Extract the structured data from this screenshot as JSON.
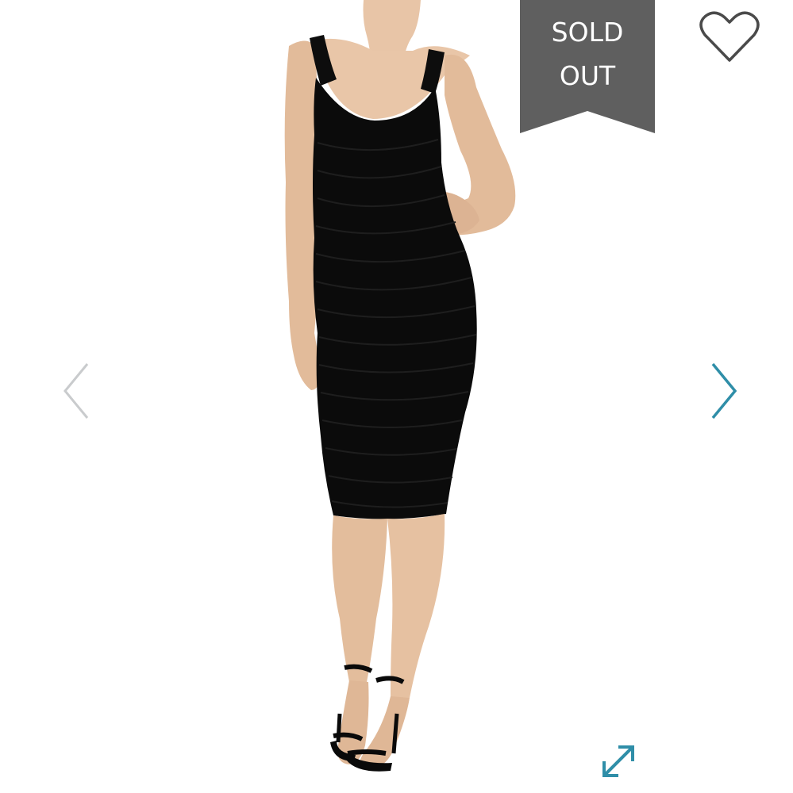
{
  "badge": {
    "line1": "SOLD",
    "line2": "OUT",
    "color": "#5f5f5f"
  },
  "colors": {
    "accent": "#2f8ea8",
    "prev_arrow": "#c9cbcd",
    "heart": "#4a4a4a"
  },
  "icons": {
    "favorite": "heart-outline-icon",
    "previous": "chevron-left-icon",
    "next": "chevron-right-icon",
    "expand": "expand-diagonal-icon"
  }
}
